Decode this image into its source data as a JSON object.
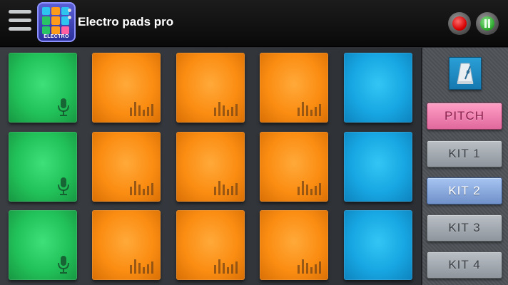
{
  "app": {
    "title": "Electro pads pro",
    "icon_label": "ELECTRO"
  },
  "toolbar": {
    "menu_icon": "hamburger-menu-icon",
    "record_icon": "record-icon",
    "pause_icon": "pause-icon"
  },
  "pads": {
    "rows": [
      [
        {
          "color": "green",
          "icon": "mic"
        },
        {
          "color": "orange",
          "icon": "eq"
        },
        {
          "color": "orange",
          "icon": "eq"
        },
        {
          "color": "orange",
          "icon": "eq"
        },
        {
          "color": "blue",
          "icon": "none"
        }
      ],
      [
        {
          "color": "green",
          "icon": "mic"
        },
        {
          "color": "orange",
          "icon": "eq"
        },
        {
          "color": "orange",
          "icon": "eq"
        },
        {
          "color": "orange",
          "icon": "eq"
        },
        {
          "color": "blue",
          "icon": "none"
        }
      ],
      [
        {
          "color": "green",
          "icon": "mic"
        },
        {
          "color": "orange",
          "icon": "eq"
        },
        {
          "color": "orange",
          "icon": "eq"
        },
        {
          "color": "orange",
          "icon": "eq"
        },
        {
          "color": "blue",
          "icon": "none"
        }
      ]
    ]
  },
  "side_panel": {
    "metronome_icon": "metronome-icon",
    "pitch_label": "PITCH",
    "kits": [
      {
        "label": "KIT 1",
        "active": false
      },
      {
        "label": "KIT 2",
        "active": true
      },
      {
        "label": "KIT 3",
        "active": false
      },
      {
        "label": "KIT 4",
        "active": false
      }
    ]
  },
  "colors": {
    "green": "#22c25a",
    "orange": "#fb8d12",
    "blue": "#17a6e2",
    "pitch": "#f07fae",
    "kit_active": "#8aa9de"
  }
}
